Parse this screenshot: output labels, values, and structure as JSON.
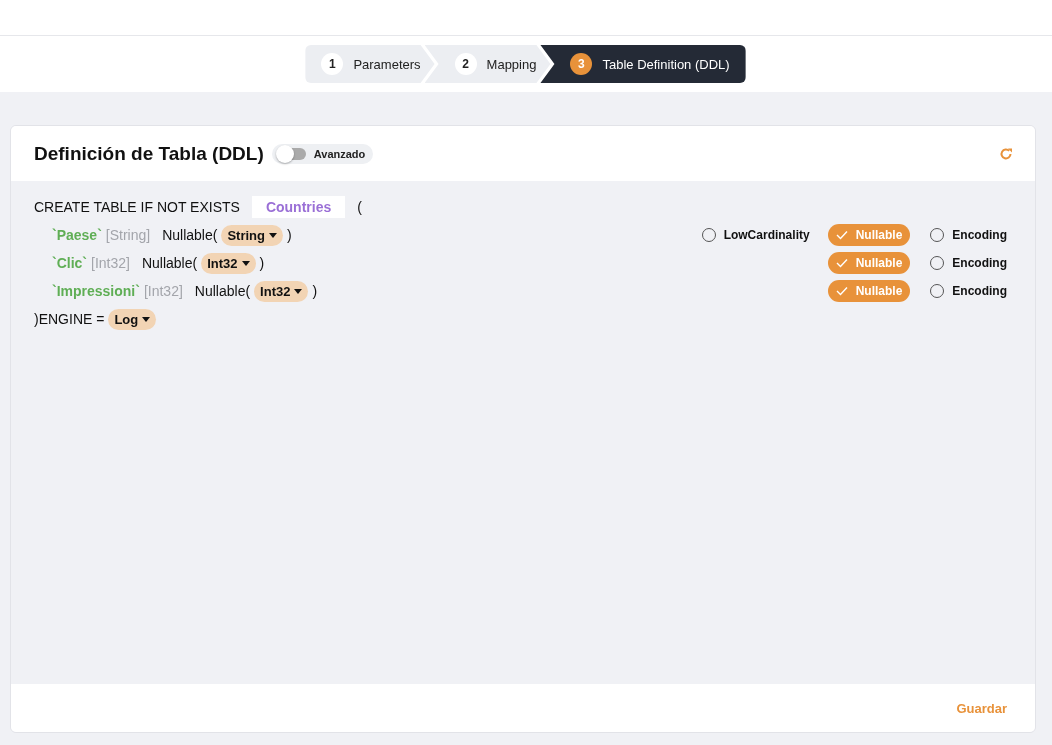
{
  "steps": [
    {
      "number": "1",
      "label": "Parameters",
      "selected": false
    },
    {
      "number": "2",
      "label": "Mapping",
      "selected": false
    },
    {
      "number": "3",
      "label": "Table Definition (DDL)",
      "selected": true
    }
  ],
  "card": {
    "title": "Definición de Tabla (DDL)",
    "toggle": {
      "label": "Avanzado",
      "on": false
    },
    "create_prefix": "CREATE TABLE IF NOT EXISTS",
    "table_name": "Countries",
    "open_paren": "(",
    "columns": [
      {
        "name": "`Paese`",
        "source_type": "[String]",
        "wrapper": "Nullable(",
        "type": "String",
        "close": ")",
        "options": [
          {
            "label": "LowCardinality",
            "checked": false
          },
          {
            "label": "Nullable",
            "checked": true
          },
          {
            "label": "Encoding",
            "checked": false
          }
        ]
      },
      {
        "name": "`Clic`",
        "source_type": "[Int32]",
        "wrapper": "Nullable(",
        "type": "Int32",
        "close": ")",
        "options": [
          {
            "label": "Nullable",
            "checked": true
          },
          {
            "label": "Encoding",
            "checked": false
          }
        ]
      },
      {
        "name": "`Impressioni`",
        "source_type": "[Int32]",
        "wrapper": "Nullable(",
        "type": "Int32",
        "close": ")",
        "options": [
          {
            "label": "Nullable",
            "checked": true
          },
          {
            "label": "Encoding",
            "checked": false
          }
        ]
      }
    ],
    "engine_label": ")ENGINE =",
    "engine": "Log",
    "save_button": "Guardar"
  }
}
